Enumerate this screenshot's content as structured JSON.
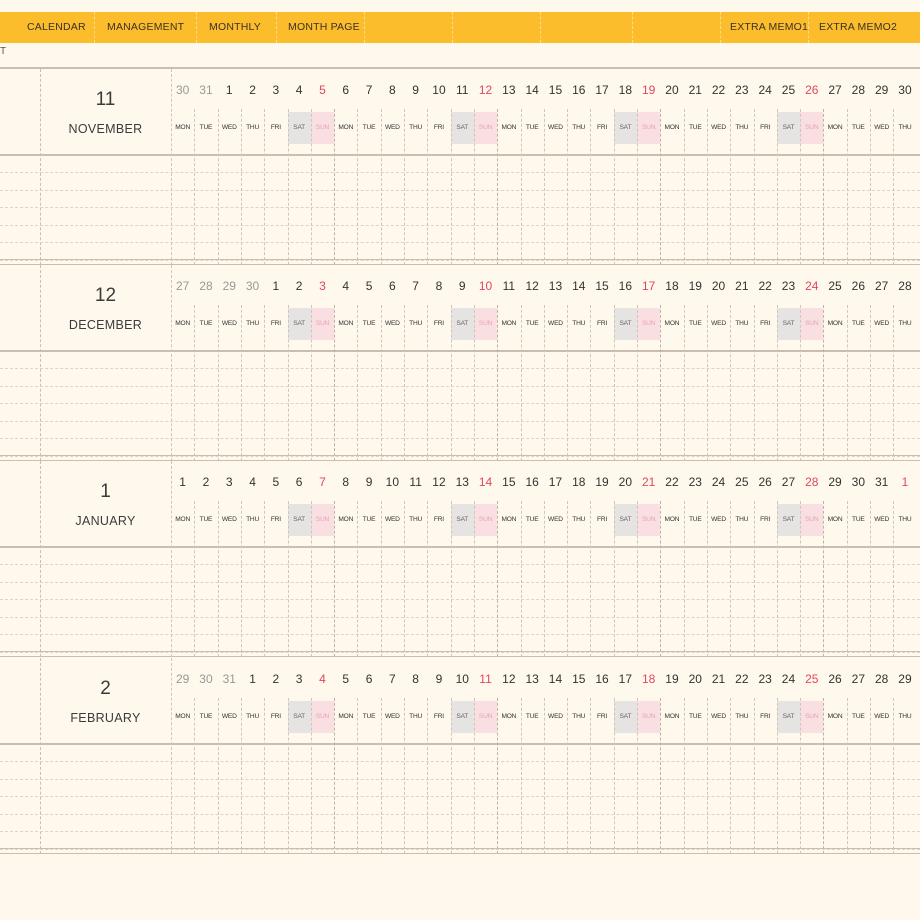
{
  "nav": {
    "items": [
      {
        "label": "CALENDAR"
      },
      {
        "label": "MANAGEMENT"
      },
      {
        "label": "MONTHLY"
      },
      {
        "label": "MONTH PAGE"
      },
      {
        "label": "EXTRA MEMO1"
      },
      {
        "label": "EXTRA MEMO2"
      }
    ]
  },
  "edge_label": "T",
  "months": [
    {
      "num": "11",
      "name": "NOVEMBER",
      "days": [
        "30",
        "31",
        "1",
        "2",
        "3",
        "4",
        "5",
        "6",
        "7",
        "8",
        "9",
        "10",
        "11",
        "12",
        "13",
        "14",
        "15",
        "16",
        "17",
        "18",
        "19",
        "20",
        "21",
        "22",
        "23",
        "24",
        "25",
        "26",
        "27",
        "28",
        "29",
        "30"
      ],
      "other_leading": 2,
      "other_trailing": 0,
      "red_days": [
        6,
        13,
        20,
        27
      ]
    },
    {
      "num": "12",
      "name": "DECEMBER",
      "days": [
        "27",
        "28",
        "29",
        "30",
        "1",
        "2",
        "3",
        "4",
        "5",
        "6",
        "7",
        "8",
        "9",
        "10",
        "11",
        "12",
        "13",
        "14",
        "15",
        "16",
        "17",
        "18",
        "19",
        "20",
        "21",
        "22",
        "23",
        "24",
        "25",
        "26",
        "27",
        "28"
      ],
      "other_leading": 4,
      "other_trailing": 0,
      "red_days": [
        6,
        13,
        20,
        27
      ]
    },
    {
      "num": "1",
      "name": "JANUARY",
      "days": [
        "1",
        "2",
        "3",
        "4",
        "5",
        "6",
        "7",
        "8",
        "9",
        "10",
        "11",
        "12",
        "13",
        "14",
        "15",
        "16",
        "17",
        "18",
        "19",
        "20",
        "21",
        "22",
        "23",
        "24",
        "25",
        "26",
        "27",
        "28",
        "29",
        "30",
        "31",
        "1"
      ],
      "other_leading": 0,
      "other_trailing": 1,
      "red_days": [
        6,
        13,
        20,
        27,
        31
      ]
    },
    {
      "num": "2",
      "name": "FEBRUARY",
      "days": [
        "29",
        "30",
        "31",
        "1",
        "2",
        "3",
        "4",
        "5",
        "6",
        "7",
        "8",
        "9",
        "10",
        "11",
        "12",
        "13",
        "14",
        "15",
        "16",
        "17",
        "18",
        "19",
        "20",
        "21",
        "22",
        "23",
        "24",
        "25",
        "26",
        "27",
        "28",
        "29"
      ],
      "other_leading": 3,
      "other_trailing": 0,
      "red_days": [
        6,
        13,
        20,
        27
      ]
    }
  ],
  "weekdays": [
    "MON",
    "TUE",
    "WED",
    "THU",
    "FRI",
    "SAT",
    "SUN"
  ]
}
